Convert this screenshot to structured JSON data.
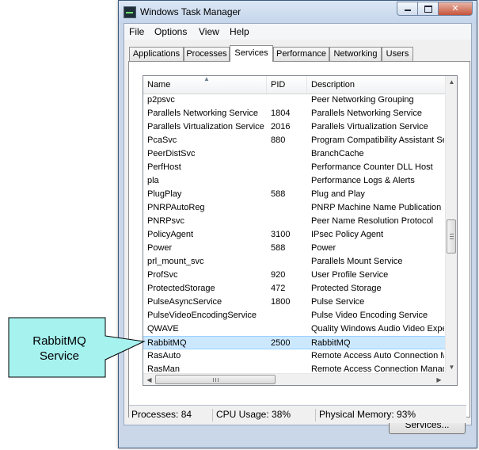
{
  "window": {
    "title": "Windows Task Manager",
    "controls": {
      "minimize": "minimize-icon",
      "maximize": "maximize-icon",
      "close": "close-icon"
    }
  },
  "menu": [
    "File",
    "Options",
    "View",
    "Help"
  ],
  "tabs": [
    "Applications",
    "Processes",
    "Services",
    "Performance",
    "Networking",
    "Users"
  ],
  "active_tab": "Services",
  "columns": {
    "name": "Name",
    "pid": "PID",
    "description": "Description"
  },
  "rows": [
    {
      "name": "p2psvc",
      "pid": "",
      "description": "Peer Networking Grouping"
    },
    {
      "name": "Parallels Networking Service",
      "pid": "1804",
      "description": "Parallels Networking Service"
    },
    {
      "name": "Parallels Virtualization Service",
      "pid": "2016",
      "description": "Parallels Virtualization Service"
    },
    {
      "name": "PcaSvc",
      "pid": "880",
      "description": "Program Compatibility Assistant Se"
    },
    {
      "name": "PeerDistSvc",
      "pid": "",
      "description": "BranchCache"
    },
    {
      "name": "PerfHost",
      "pid": "",
      "description": "Performance Counter DLL Host"
    },
    {
      "name": "pla",
      "pid": "",
      "description": "Performance Logs & Alerts"
    },
    {
      "name": "PlugPlay",
      "pid": "588",
      "description": "Plug and Play"
    },
    {
      "name": "PNRPAutoReg",
      "pid": "",
      "description": "PNRP Machine Name Publication Se"
    },
    {
      "name": "PNRPsvc",
      "pid": "",
      "description": "Peer Name Resolution Protocol"
    },
    {
      "name": "PolicyAgent",
      "pid": "3100",
      "description": "IPsec Policy Agent"
    },
    {
      "name": "Power",
      "pid": "588",
      "description": "Power"
    },
    {
      "name": "prl_mount_svc",
      "pid": "",
      "description": "Parallels Mount Service"
    },
    {
      "name": "ProfSvc",
      "pid": "920",
      "description": "User Profile Service"
    },
    {
      "name": "ProtectedStorage",
      "pid": "472",
      "description": "Protected Storage"
    },
    {
      "name": "PulseAsyncService",
      "pid": "1800",
      "description": "Pulse Service"
    },
    {
      "name": "PulseVideoEncodingService",
      "pid": "",
      "description": "Pulse Video Encoding Service"
    },
    {
      "name": "QWAVE",
      "pid": "",
      "description": "Quality Windows Audio Video Expe"
    },
    {
      "name": "RabbitMQ",
      "pid": "2500",
      "description": "RabbitMQ"
    },
    {
      "name": "RasAuto",
      "pid": "",
      "description": "Remote Access Auto Connection M"
    },
    {
      "name": "RasMan",
      "pid": "",
      "description": "Remote Access Connection Manag"
    }
  ],
  "selected_row": "RabbitMQ",
  "services_button": "Services...",
  "status": {
    "processes": "Processes: 84",
    "cpu": "CPU Usage: 38%",
    "memory": "Physical Memory: 93%"
  },
  "callout": {
    "line1": "RabbitMQ",
    "line2": "Service"
  },
  "colors": {
    "callout_fill": "#a6f2ef",
    "selection": "#cce8ff",
    "frame": "#c9d7e9"
  }
}
